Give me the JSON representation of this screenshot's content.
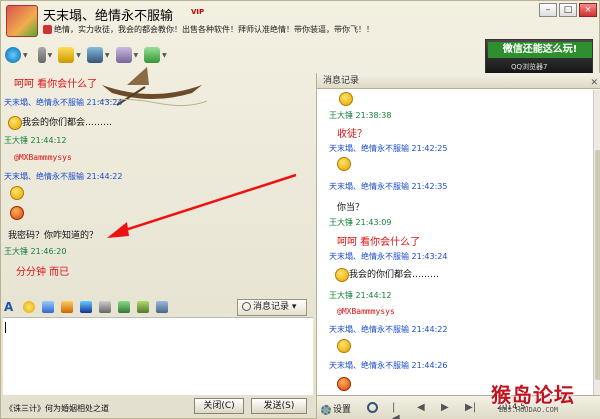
{
  "window": {
    "contact_name": "天末塌、绝情永不服输",
    "vip_badge": "VIP",
    "signature": "绝情，实力收徒，我会的都会教你！出售各种软件！拜师认准绝情！带你装逼，带你飞！！",
    "controls": {
      "minimize": "–",
      "maximize": "□",
      "close": "×"
    }
  },
  "ad": {
    "text": "微信还能这么玩!",
    "sub": "QQ浏览器7"
  },
  "chat": {
    "messages": [
      {
        "kind": "red",
        "text": "呵呵  看你会什么了"
      },
      {
        "kind": "sender-other",
        "text": "天末塌、绝情永不服输 21:43:24"
      },
      {
        "kind": "body",
        "text": "我会的你们都会………"
      },
      {
        "kind": "sender-self",
        "text": "王大锤 21:44:12"
      },
      {
        "kind": "mention",
        "text": "@MXBammmysys"
      },
      {
        "kind": "sender-other",
        "text": "天末塌、绝情永不服输 21:44:22"
      },
      {
        "kind": "body",
        "text": "我密码？你咋知道的？"
      },
      {
        "kind": "sender-self",
        "text": "王大锤 21:46:20"
      },
      {
        "kind": "red",
        "text": "分分钟 而已"
      }
    ]
  },
  "toolbar": {
    "history_label": "消息记录"
  },
  "footer": {
    "news": "《诛三计》何为婚姻相处之道",
    "close_label": "关闭(C)",
    "send_label": "发送(S)"
  },
  "history": {
    "title": "消息记录",
    "messages": [
      {
        "kind": "sender-self",
        "text": "王大锤 21:38:38"
      },
      {
        "kind": "red",
        "text": "收徒？"
      },
      {
        "kind": "sender-other",
        "text": "天末塌、绝情永不服输 21:42:25"
      },
      {
        "kind": "sender-other",
        "text": "天末塌、绝情永不服输 21:42:35"
      },
      {
        "kind": "body",
        "text": "你当？"
      },
      {
        "kind": "sender-self",
        "text": "王大锤 21:43:09"
      },
      {
        "kind": "red",
        "text": "呵呵  看你会什么了"
      },
      {
        "kind": "sender-other",
        "text": "天末塌、绝情永不服输 21:43:24"
      },
      {
        "kind": "body",
        "text": "我会的你们都会………"
      },
      {
        "kind": "sender-self",
        "text": "王大锤 21:44:12"
      },
      {
        "kind": "mention",
        "text": "@MXBammmysys"
      },
      {
        "kind": "sender-other",
        "text": "天末塌、绝情永不服输 21:44:22"
      },
      {
        "kind": "sender-other",
        "text": "天末塌、绝情永不服输 21:44:26"
      }
    ],
    "settings_label": "设置",
    "date": "2014-5-"
  },
  "watermark": {
    "main": "猴岛论坛",
    "sub": "BBS.HOUDAO.COM"
  }
}
